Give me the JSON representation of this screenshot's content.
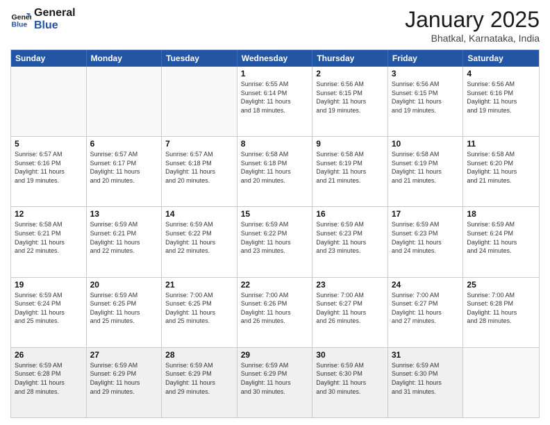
{
  "header": {
    "logo_line1": "General",
    "logo_line2": "Blue",
    "title": "January 2025",
    "location": "Bhatkal, Karnataka, India"
  },
  "days_of_week": [
    "Sunday",
    "Monday",
    "Tuesday",
    "Wednesday",
    "Thursday",
    "Friday",
    "Saturday"
  ],
  "weeks": [
    [
      {
        "day": "",
        "info": "",
        "empty": true
      },
      {
        "day": "",
        "info": "",
        "empty": true
      },
      {
        "day": "",
        "info": "",
        "empty": true
      },
      {
        "day": "1",
        "info": "Sunrise: 6:55 AM\nSunset: 6:14 PM\nDaylight: 11 hours\nand 18 minutes."
      },
      {
        "day": "2",
        "info": "Sunrise: 6:56 AM\nSunset: 6:15 PM\nDaylight: 11 hours\nand 19 minutes."
      },
      {
        "day": "3",
        "info": "Sunrise: 6:56 AM\nSunset: 6:15 PM\nDaylight: 11 hours\nand 19 minutes."
      },
      {
        "day": "4",
        "info": "Sunrise: 6:56 AM\nSunset: 6:16 PM\nDaylight: 11 hours\nand 19 minutes."
      }
    ],
    [
      {
        "day": "5",
        "info": "Sunrise: 6:57 AM\nSunset: 6:16 PM\nDaylight: 11 hours\nand 19 minutes."
      },
      {
        "day": "6",
        "info": "Sunrise: 6:57 AM\nSunset: 6:17 PM\nDaylight: 11 hours\nand 20 minutes."
      },
      {
        "day": "7",
        "info": "Sunrise: 6:57 AM\nSunset: 6:18 PM\nDaylight: 11 hours\nand 20 minutes."
      },
      {
        "day": "8",
        "info": "Sunrise: 6:58 AM\nSunset: 6:18 PM\nDaylight: 11 hours\nand 20 minutes."
      },
      {
        "day": "9",
        "info": "Sunrise: 6:58 AM\nSunset: 6:19 PM\nDaylight: 11 hours\nand 21 minutes."
      },
      {
        "day": "10",
        "info": "Sunrise: 6:58 AM\nSunset: 6:19 PM\nDaylight: 11 hours\nand 21 minutes."
      },
      {
        "day": "11",
        "info": "Sunrise: 6:58 AM\nSunset: 6:20 PM\nDaylight: 11 hours\nand 21 minutes."
      }
    ],
    [
      {
        "day": "12",
        "info": "Sunrise: 6:58 AM\nSunset: 6:21 PM\nDaylight: 11 hours\nand 22 minutes."
      },
      {
        "day": "13",
        "info": "Sunrise: 6:59 AM\nSunset: 6:21 PM\nDaylight: 11 hours\nand 22 minutes."
      },
      {
        "day": "14",
        "info": "Sunrise: 6:59 AM\nSunset: 6:22 PM\nDaylight: 11 hours\nand 22 minutes."
      },
      {
        "day": "15",
        "info": "Sunrise: 6:59 AM\nSunset: 6:22 PM\nDaylight: 11 hours\nand 23 minutes."
      },
      {
        "day": "16",
        "info": "Sunrise: 6:59 AM\nSunset: 6:23 PM\nDaylight: 11 hours\nand 23 minutes."
      },
      {
        "day": "17",
        "info": "Sunrise: 6:59 AM\nSunset: 6:23 PM\nDaylight: 11 hours\nand 24 minutes."
      },
      {
        "day": "18",
        "info": "Sunrise: 6:59 AM\nSunset: 6:24 PM\nDaylight: 11 hours\nand 24 minutes."
      }
    ],
    [
      {
        "day": "19",
        "info": "Sunrise: 6:59 AM\nSunset: 6:24 PM\nDaylight: 11 hours\nand 25 minutes."
      },
      {
        "day": "20",
        "info": "Sunrise: 6:59 AM\nSunset: 6:25 PM\nDaylight: 11 hours\nand 25 minutes."
      },
      {
        "day": "21",
        "info": "Sunrise: 7:00 AM\nSunset: 6:25 PM\nDaylight: 11 hours\nand 25 minutes."
      },
      {
        "day": "22",
        "info": "Sunrise: 7:00 AM\nSunset: 6:26 PM\nDaylight: 11 hours\nand 26 minutes."
      },
      {
        "day": "23",
        "info": "Sunrise: 7:00 AM\nSunset: 6:27 PM\nDaylight: 11 hours\nand 26 minutes."
      },
      {
        "day": "24",
        "info": "Sunrise: 7:00 AM\nSunset: 6:27 PM\nDaylight: 11 hours\nand 27 minutes."
      },
      {
        "day": "25",
        "info": "Sunrise: 7:00 AM\nSunset: 6:28 PM\nDaylight: 11 hours\nand 28 minutes."
      }
    ],
    [
      {
        "day": "26",
        "info": "Sunrise: 6:59 AM\nSunset: 6:28 PM\nDaylight: 11 hours\nand 28 minutes."
      },
      {
        "day": "27",
        "info": "Sunrise: 6:59 AM\nSunset: 6:29 PM\nDaylight: 11 hours\nand 29 minutes."
      },
      {
        "day": "28",
        "info": "Sunrise: 6:59 AM\nSunset: 6:29 PM\nDaylight: 11 hours\nand 29 minutes."
      },
      {
        "day": "29",
        "info": "Sunrise: 6:59 AM\nSunset: 6:29 PM\nDaylight: 11 hours\nand 30 minutes."
      },
      {
        "day": "30",
        "info": "Sunrise: 6:59 AM\nSunset: 6:30 PM\nDaylight: 11 hours\nand 30 minutes."
      },
      {
        "day": "31",
        "info": "Sunrise: 6:59 AM\nSunset: 6:30 PM\nDaylight: 11 hours\nand 31 minutes."
      },
      {
        "day": "",
        "info": "",
        "empty": true
      }
    ]
  ]
}
